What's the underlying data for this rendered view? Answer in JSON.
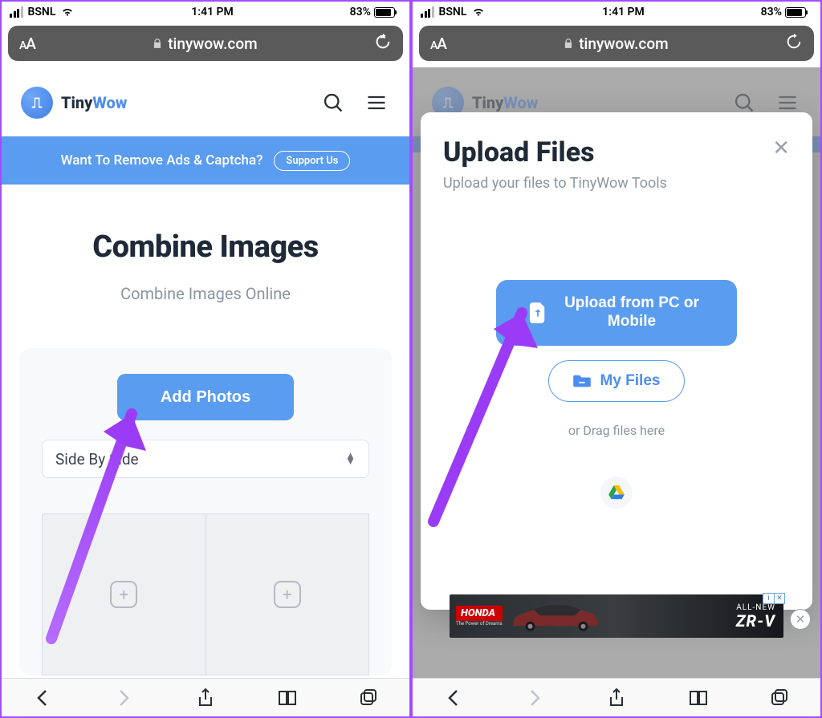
{
  "status": {
    "carrier": "BSNL",
    "time": "1:41 PM",
    "battery_pct": "83%"
  },
  "browser": {
    "text_size_label": "A",
    "domain": "tinywow.com"
  },
  "brand": {
    "name_a": "Tiny",
    "name_b": "Wow"
  },
  "banner": {
    "text": "Want To Remove Ads & Captcha?",
    "cta": "Support Us"
  },
  "page": {
    "title": "Combine Images",
    "subtitle": "Combine Images Online",
    "add_photos": "Add Photos",
    "layout_select": "Side By Side"
  },
  "modal": {
    "title": "Upload Files",
    "subtitle": "Upload your files to TinyWow Tools",
    "upload_btn": "Upload from PC or Mobile",
    "my_files": "My Files",
    "drag_hint": "or Drag files here"
  },
  "ad": {
    "brand": "HONDA",
    "tagline": "The Power of Dreams",
    "headline_small": "ALL-NEW",
    "headline_big": "ZR-V",
    "info_i": "i",
    "info_x": "✕"
  }
}
